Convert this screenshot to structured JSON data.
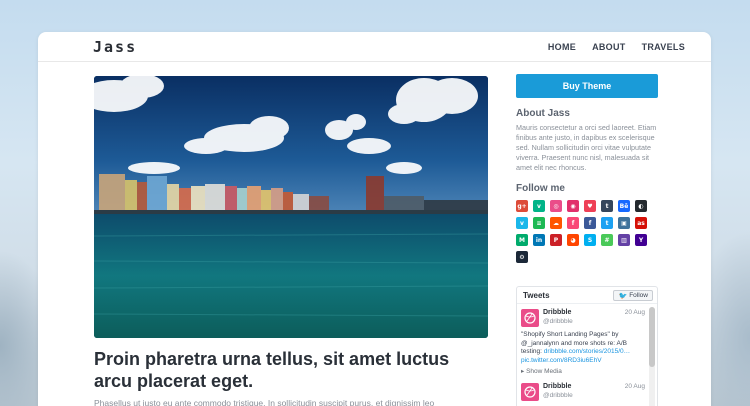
{
  "site": {
    "logo": "Jass",
    "nav": [
      "HOME",
      "ABOUT",
      "TRAVELS"
    ]
  },
  "post": {
    "title": "Proin pharetra urna tellus, sit amet luctus arcu placerat eget.",
    "excerpt": "Phasellus ut justo eu ante commodo tristique. In sollicitudin suscipit purus, et dignissim leo"
  },
  "sidebar": {
    "buy_label": "Buy Theme",
    "about_title": "About Jass",
    "about_text": "Mauris consectetur a orci sed laoreet. Etiam finibus ante justo, in dapibus ex scelerisque sed. Nullam sollicitudin orci vitae vulputate viverra. Praesent nunc nisl, malesuada sit amet elit nec rhoncus.",
    "follow_title": "Follow me",
    "social": [
      {
        "name": "google-plus-icon",
        "glyph": "g+",
        "color": "#dd4b39"
      },
      {
        "name": "vine-icon",
        "glyph": "v",
        "color": "#00b488"
      },
      {
        "name": "dribbble-icon",
        "glyph": "◎",
        "color": "#ea4c89"
      },
      {
        "name": "instagram-icon",
        "glyph": "◉",
        "color": "#e1306c"
      },
      {
        "name": "pocket-icon",
        "glyph": "♥",
        "color": "#ee4056"
      },
      {
        "name": "tumblr-icon",
        "glyph": "t",
        "color": "#35465c"
      },
      {
        "name": "behance-icon",
        "glyph": "Bē",
        "color": "#1769ff"
      },
      {
        "name": "github-icon",
        "glyph": "◐",
        "color": "#24292e"
      },
      {
        "name": "vimeo-icon",
        "glyph": "v",
        "color": "#1ab7ea"
      },
      {
        "name": "spotify-icon",
        "glyph": "≡",
        "color": "#1db954"
      },
      {
        "name": "soundcloud-icon",
        "glyph": "☁",
        "color": "#ff5500"
      },
      {
        "name": "foursquare-icon",
        "glyph": "f",
        "color": "#f94877"
      },
      {
        "name": "facebook-icon",
        "glyph": "f",
        "color": "#3b5998"
      },
      {
        "name": "twitter-icon",
        "glyph": "t",
        "color": "#1da1f2"
      },
      {
        "name": "instagram-alt-icon",
        "glyph": "▣",
        "color": "#3f729b"
      },
      {
        "name": "lastfm-icon",
        "glyph": "as",
        "color": "#d51007"
      },
      {
        "name": "medium-icon",
        "glyph": "M",
        "color": "#00ab6c"
      },
      {
        "name": "linkedin-icon",
        "glyph": "in",
        "color": "#0077b5"
      },
      {
        "name": "pinterest-icon",
        "glyph": "P",
        "color": "#cb2027"
      },
      {
        "name": "reddit-icon",
        "glyph": "◕",
        "color": "#ff4500"
      },
      {
        "name": "skype-icon",
        "glyph": "S",
        "color": "#00aff0"
      },
      {
        "name": "slack-icon",
        "glyph": "#",
        "color": "#4ac959"
      },
      {
        "name": "twitch-icon",
        "glyph": "▥",
        "color": "#6441a5"
      },
      {
        "name": "yahoo-icon",
        "glyph": "Y",
        "color": "#410093"
      },
      {
        "name": "steam-icon",
        "glyph": "⚙",
        "color": "#1b2838"
      }
    ]
  },
  "tweets": {
    "title": "Tweets",
    "follow_label": "Follow",
    "items": [
      {
        "name": "Dribbble",
        "handle": "@dribbble",
        "date": "20 Aug",
        "text_a": "\"Shopify Short Landing Pages\" by",
        "text_b": "@_jannalynn and more shots re: A/B",
        "text_c": "testing:",
        "link": "dribbble.com/stories/2015/0…",
        "link2": "pic.twitter.com/8RD3iu6EhV",
        "show_media": "Show Media"
      },
      {
        "name": "Dribbble",
        "handle": "@dribbble",
        "date": "20 Aug"
      }
    ]
  }
}
